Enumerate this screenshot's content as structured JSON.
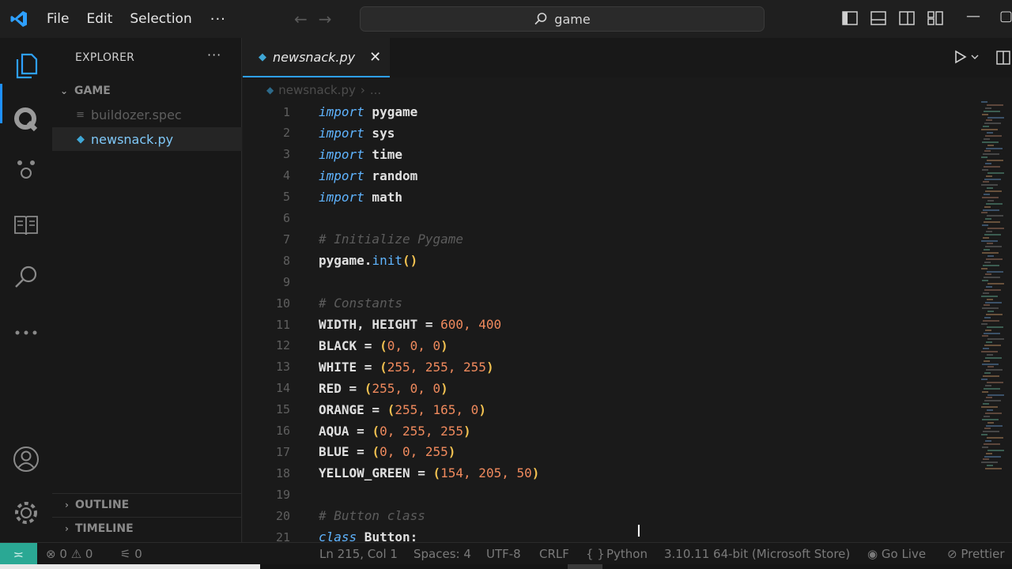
{
  "titlebar": {
    "menu": [
      "File",
      "Edit",
      "Selection"
    ],
    "more": "···",
    "search_text": "game",
    "accent": "#2ea0ff"
  },
  "activity": {
    "icons": [
      "files-icon",
      "extension-q-icon",
      "debug-icon",
      "book-icon",
      "search-icon",
      "more-icon",
      "account-icon",
      "settings-icon"
    ]
  },
  "sidebar": {
    "title": "EXPLORER",
    "more": "···",
    "folder": "GAME",
    "files": [
      {
        "name": "buildozer.spec",
        "icon": "≡"
      },
      {
        "name": "newsnack.py",
        "icon": "◆"
      }
    ],
    "outline": "OUTLINE",
    "timeline": "TIMELINE"
  },
  "editor": {
    "tab_label": "newsnack.py",
    "tab_close": "✕",
    "breadcrumb_file": "newsnack.py",
    "breadcrumb_sep": "›",
    "breadcrumb_tail": "...",
    "lines": [
      {
        "n": "1",
        "k": "import",
        "r": " pygame"
      },
      {
        "n": "2",
        "k": "import",
        "r": " sys"
      },
      {
        "n": "3",
        "k": "import",
        "r": " time"
      },
      {
        "n": "4",
        "k": "import",
        "r": " random"
      },
      {
        "n": "5",
        "k": "import",
        "r": " math"
      },
      {
        "n": "6"
      },
      {
        "n": "7",
        "c": "# Initialize Pygame"
      },
      {
        "n": "8",
        "p": "pygame.",
        "f": "init",
        "s": "()"
      },
      {
        "n": "9"
      },
      {
        "n": "10",
        "c": "# Constants"
      },
      {
        "n": "11",
        "v": "WIDTH, HEIGHT = ",
        "nums": "600, 400"
      },
      {
        "n": "12",
        "v": "BLACK = ",
        "t": "0, 0, 0"
      },
      {
        "n": "13",
        "v": "WHITE = ",
        "t": "255, 255, 255"
      },
      {
        "n": "14",
        "v": "RED = ",
        "t": "255, 0, 0"
      },
      {
        "n": "15",
        "v": "ORANGE = ",
        "t": "255, 165, 0"
      },
      {
        "n": "16",
        "v": "AQUA = ",
        "t": "0, 255, 255"
      },
      {
        "n": "17",
        "v": "BLUE = ",
        "t": "0, 0, 255"
      },
      {
        "n": "18",
        "v": "YELLOW_GREEN = ",
        "t": "154, 205, 50"
      },
      {
        "n": "19"
      },
      {
        "n": "20",
        "c": "# Button class"
      },
      {
        "n": "21",
        "k": "class",
        "r": " Button:"
      }
    ]
  },
  "statusbar": {
    "errors": "0",
    "warnings": "0",
    "ports": "0",
    "position": "Ln 215, Col 1",
    "spaces": "Spaces: 4",
    "encoding": "UTF-8",
    "eol": "CRLF",
    "braces": "{ }",
    "language": "Python",
    "interpreter": "3.10.11 64-bit (Microsoft Store)",
    "golive": "Go Live",
    "prettier": "Prettier"
  }
}
